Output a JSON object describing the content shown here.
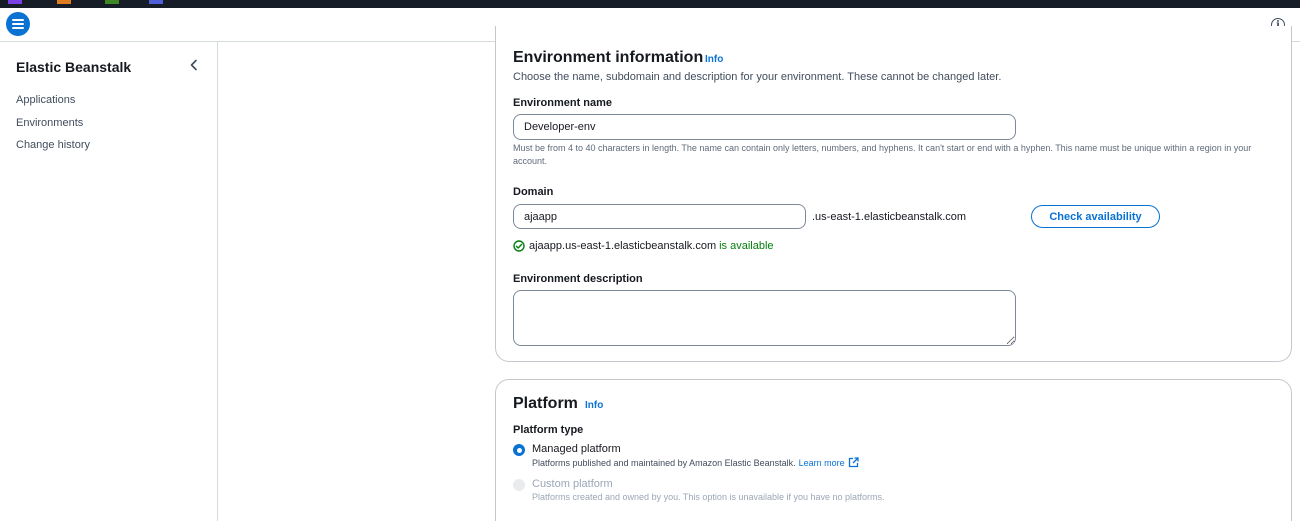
{
  "header": {
    "menu_icon": "hamburger-menu-icon",
    "info_icon": "info-circle-icon",
    "info_glyph": "i"
  },
  "sidebar": {
    "title": "Elastic Beanstalk",
    "collapse_icon": "chevron-left-icon",
    "items": [
      {
        "label": "Applications"
      },
      {
        "label": "Environments"
      },
      {
        "label": "Change history"
      }
    ]
  },
  "env_info": {
    "title": "Environment information",
    "info_link": "Info",
    "description": "Choose the name, subdomain and description for your environment. These cannot be changed later.",
    "name_label": "Environment name",
    "name_value": "Developer-env",
    "name_hint": "Must be from 4 to 40 characters in length. The name can contain only letters, numbers, and hyphens. It can't start or end with a hyphen. This name must be unique within a region in your account.",
    "domain_label": "Domain",
    "domain_value": "ajaapp",
    "domain_suffix": ".us-east-1.elasticbeanstalk.com",
    "check_button": "Check availability",
    "status_domain": "ajaapp.us-east-1.elasticbeanstalk.com",
    "status_text": "is available",
    "status_icon": "check-circle-icon",
    "description_label": "Environment description",
    "description_value": ""
  },
  "platform": {
    "title": "Platform",
    "info_link": "Info",
    "type_label": "Platform type",
    "options": [
      {
        "label": "Managed platform",
        "description": "Platforms published and maintained by Amazon Elastic Beanstalk.",
        "link": "Learn more",
        "selected": true,
        "disabled": false
      },
      {
        "label": "Custom platform",
        "description": "Platforms created and owned by you. This option is unavailable if you have no platforms.",
        "selected": false,
        "disabled": true
      }
    ]
  },
  "colors": {
    "accent": "#0972d3",
    "success": "#037f0c",
    "top_strip": "#161d26"
  }
}
